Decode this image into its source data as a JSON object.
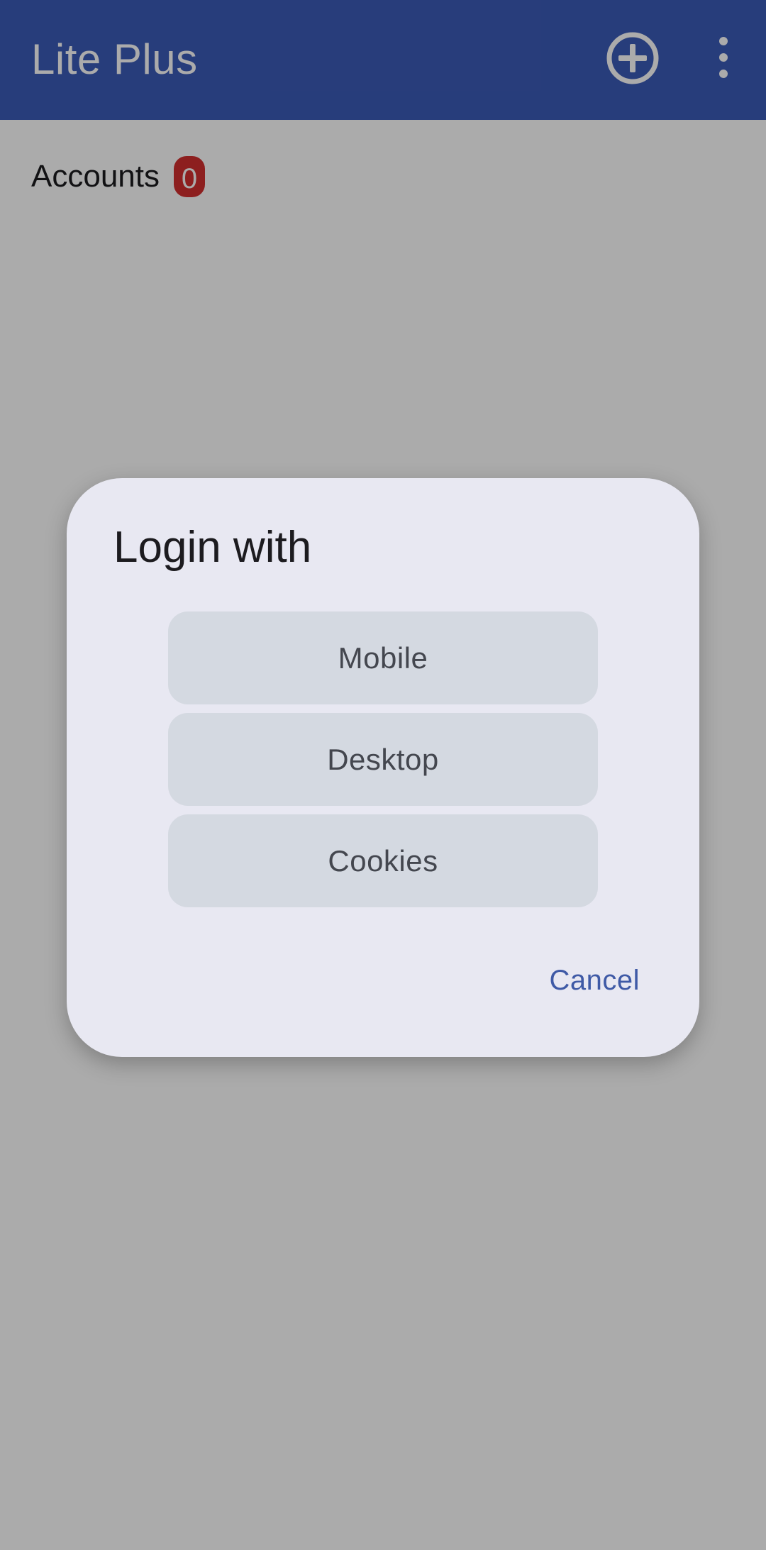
{
  "app": {
    "title": "Lite Plus",
    "add_icon": "add-circle-icon",
    "more_icon": "more-vert-icon"
  },
  "accounts": {
    "label": "Accounts",
    "count": "0"
  },
  "dialog": {
    "title": "Login with",
    "options": [
      {
        "label": "Mobile"
      },
      {
        "label": "Desktop"
      },
      {
        "label": "Cookies"
      }
    ],
    "cancel_label": "Cancel"
  },
  "colors": {
    "app_bar": "#3b5bb8",
    "badge": "#d32f2f",
    "dialog_bg": "#e8e8f2",
    "option_bg": "#d4d9e1",
    "accent_text": "#3f5aa6"
  }
}
